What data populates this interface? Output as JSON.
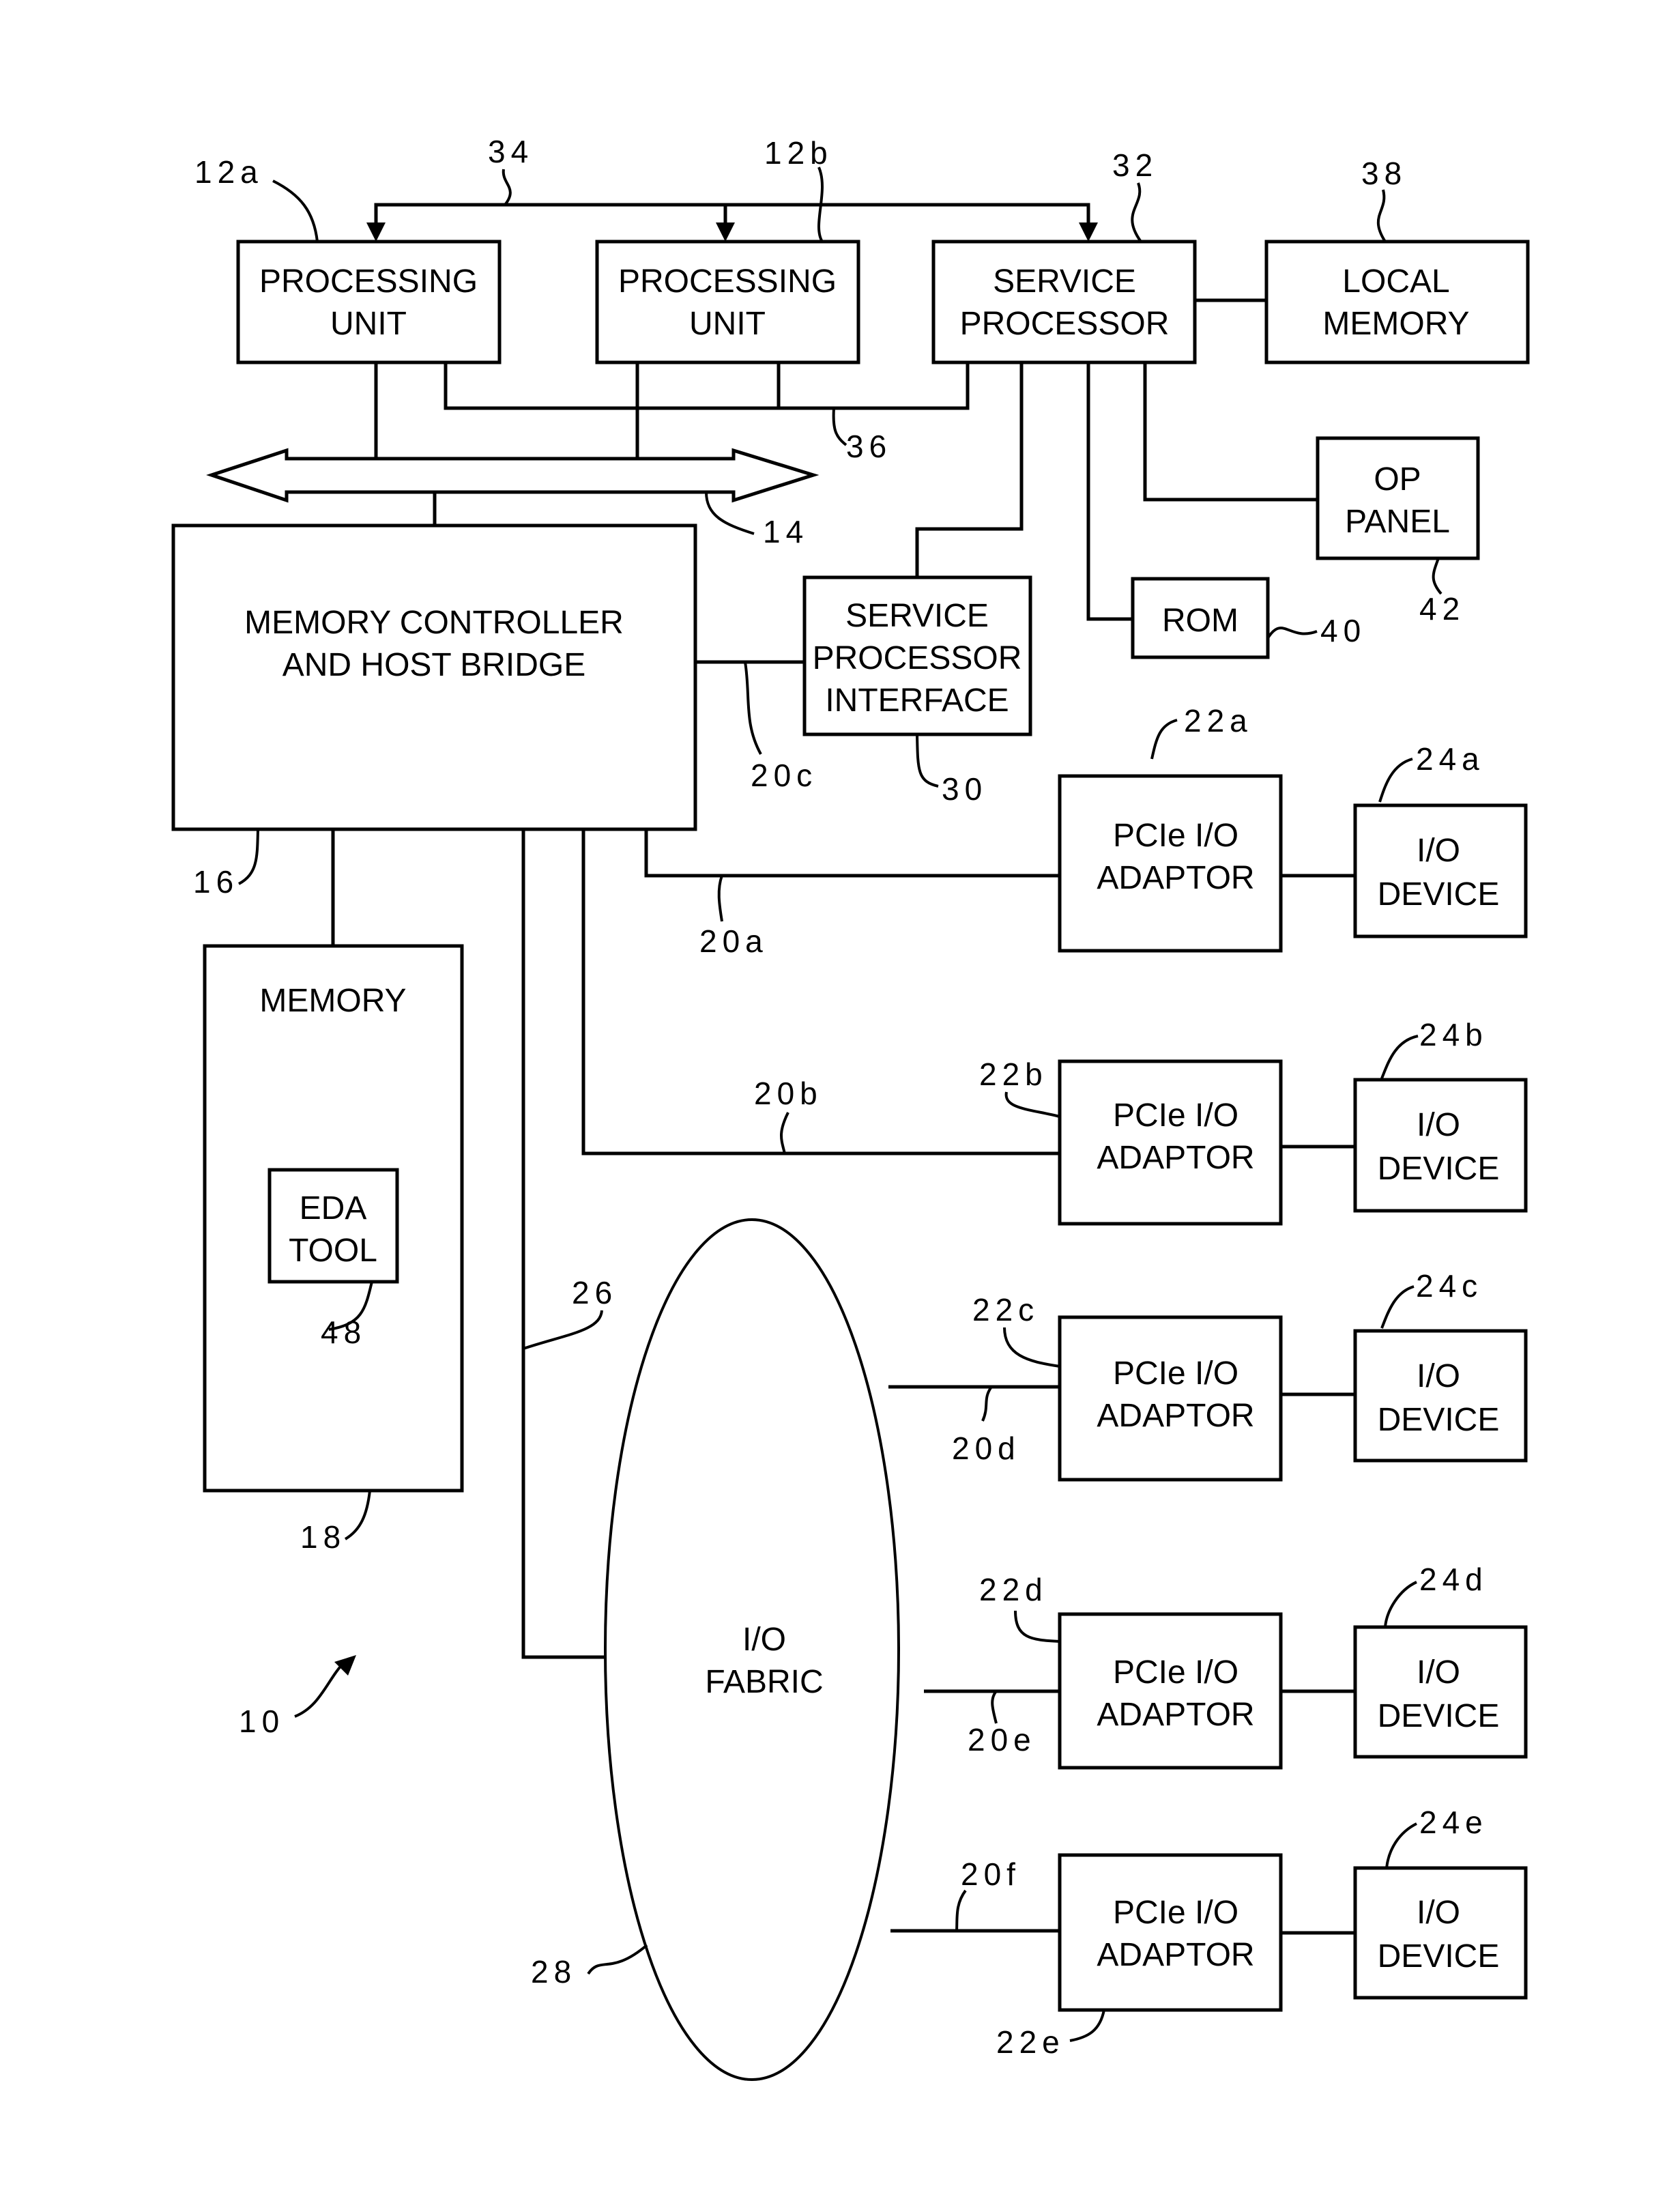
{
  "figure": {
    "system_ref": "10",
    "processing_units": [
      {
        "ref": "12a",
        "lines": [
          "PROCESSING",
          "UNIT"
        ]
      },
      {
        "ref": "12b",
        "lines": [
          "PROCESSING",
          "UNIT"
        ]
      }
    ],
    "service_processor": {
      "ref": "32",
      "lines": [
        "SERVICE",
        "PROCESSOR"
      ]
    },
    "local_memory": {
      "ref": "38",
      "lines": [
        "LOCAL",
        "MEMORY"
      ]
    },
    "op_panel": {
      "ref": "42",
      "lines": [
        "OP",
        "PANEL"
      ]
    },
    "rom": {
      "ref": "40",
      "lines": [
        "ROM"
      ]
    },
    "sp_interface": {
      "ref": "30",
      "lines": [
        "SERVICE",
        "PROCESSOR",
        "INTERFACE"
      ]
    },
    "memory_controller": {
      "ref": "16",
      "lines": [
        "MEMORY CONTROLLER",
        "AND HOST BRIDGE"
      ]
    },
    "memory": {
      "ref": "18",
      "lines": [
        "MEMORY"
      ]
    },
    "eda_tool": {
      "ref": "48",
      "lines": [
        "EDA",
        "TOOL"
      ]
    },
    "io_fabric": {
      "ref": "28",
      "lines": [
        "I/O",
        "FABRIC"
      ]
    },
    "buses": {
      "sp_bus": "34",
      "jtag_bus": "36",
      "system_bus": "14",
      "fabric_link": "26",
      "links": [
        "20a",
        "20b",
        "20c",
        "20d",
        "20e",
        "20f"
      ]
    },
    "adaptors": [
      {
        "ref": "22a",
        "lines": [
          "PCIe I/O",
          "ADAPTOR"
        ]
      },
      {
        "ref": "22b",
        "lines": [
          "PCIe I/O",
          "ADAPTOR"
        ]
      },
      {
        "ref": "22c",
        "lines": [
          "PCIe I/O",
          "ADAPTOR"
        ]
      },
      {
        "ref": "22d",
        "lines": [
          "PCIe I/O",
          "ADAPTOR"
        ]
      },
      {
        "ref": "22e",
        "lines": [
          "PCIe I/O",
          "ADAPTOR"
        ]
      }
    ],
    "devices": [
      {
        "ref": "24a",
        "lines": [
          "I/O",
          "DEVICE"
        ]
      },
      {
        "ref": "24b",
        "lines": [
          "I/O",
          "DEVICE"
        ]
      },
      {
        "ref": "24c",
        "lines": [
          "I/O",
          "DEVICE"
        ]
      },
      {
        "ref": "24d",
        "lines": [
          "I/O",
          "DEVICE"
        ]
      },
      {
        "ref": "24e",
        "lines": [
          "I/O",
          "DEVICE"
        ]
      }
    ]
  }
}
